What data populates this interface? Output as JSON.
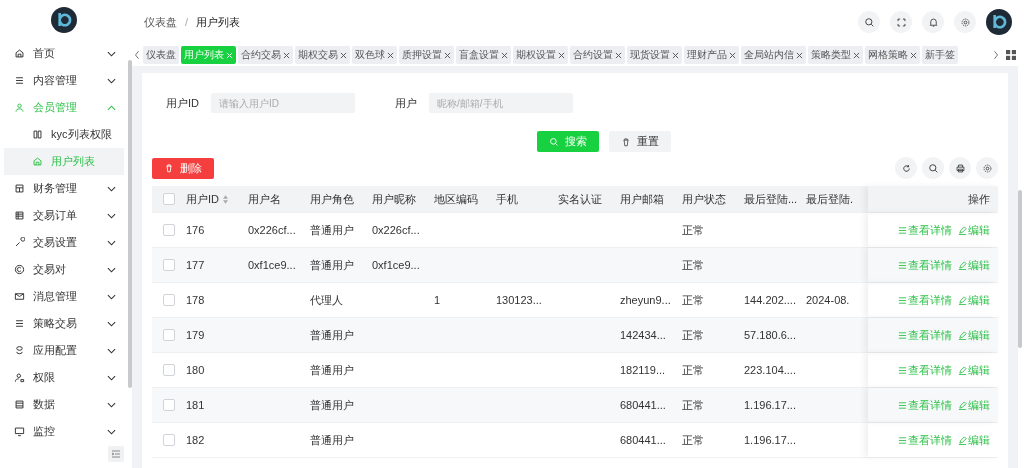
{
  "header": {
    "breadcrumb_separator": "/",
    "breadcrumb": [
      {
        "label": "仪表盘",
        "selected": false
      },
      {
        "label": "用户列表",
        "selected": true
      }
    ]
  },
  "sidebar": {
    "items": [
      {
        "label": "首页",
        "expanded": false
      },
      {
        "label": "内容管理",
        "expanded": false
      },
      {
        "label": "会员管理",
        "expanded": true,
        "children": [
          {
            "label": "kyc列表权限",
            "selected": false
          },
          {
            "label": "用户列表",
            "selected": true
          }
        ]
      },
      {
        "label": "财务管理",
        "expanded": false
      },
      {
        "label": "交易订单",
        "expanded": false
      },
      {
        "label": "交易设置",
        "expanded": false
      },
      {
        "label": "交易对",
        "expanded": false
      },
      {
        "label": "消息管理",
        "expanded": false
      },
      {
        "label": "策略交易",
        "expanded": false
      },
      {
        "label": "应用配置",
        "expanded": false
      },
      {
        "label": "权限",
        "expanded": false
      },
      {
        "label": "数据",
        "expanded": false
      },
      {
        "label": "监控",
        "expanded": false
      }
    ]
  },
  "tabs": [
    {
      "label": "仪表盘",
      "selected": false,
      "closable": false
    },
    {
      "label": "用户列表",
      "selected": true,
      "closable": true
    },
    {
      "label": "合约交易",
      "selected": false,
      "closable": true
    },
    {
      "label": "期权交易",
      "selected": false,
      "closable": true
    },
    {
      "label": "双色球",
      "selected": false,
      "closable": true
    },
    {
      "label": "质押设置",
      "selected": false,
      "closable": true
    },
    {
      "label": "盲盒设置",
      "selected": false,
      "closable": true
    },
    {
      "label": "期权设置",
      "selected": false,
      "closable": true
    },
    {
      "label": "合约设置",
      "selected": false,
      "closable": true
    },
    {
      "label": "现货设置",
      "selected": false,
      "closable": true
    },
    {
      "label": "理财产品",
      "selected": false,
      "closable": true
    },
    {
      "label": "全局站内信",
      "selected": false,
      "closable": true
    },
    {
      "label": "策略类型",
      "selected": false,
      "closable": true
    },
    {
      "label": "网格策略",
      "selected": false,
      "closable": true
    },
    {
      "label": "新手签",
      "selected": false,
      "closable": false
    }
  ],
  "filters": [
    {
      "label": "用户ID",
      "placeholder": "请输入用户ID"
    },
    {
      "label": "用户",
      "placeholder": "昵称/邮箱/手机"
    }
  ],
  "buttons": {
    "search": "搜索",
    "reset": "重置",
    "delete": "删除"
  },
  "table": {
    "select_all": {
      "checked": false
    },
    "columns": [
      {
        "label": "用户ID",
        "sortable": true
      },
      {
        "label": "用户名",
        "sortable": false
      },
      {
        "label": "用户角色",
        "sortable": false
      },
      {
        "label": "用户昵称",
        "sortable": false
      },
      {
        "label": "地区编码",
        "sortable": false
      },
      {
        "label": "手机",
        "sortable": false
      },
      {
        "label": "实名认证",
        "sortable": false
      },
      {
        "label": "用户邮箱",
        "sortable": false
      },
      {
        "label": "用户状态",
        "sortable": false
      },
      {
        "label": "最后登陆...",
        "sortable": false
      },
      {
        "label": "最后登陆.",
        "sortable": false
      }
    ],
    "action_column": "操作",
    "rows": [
      {
        "checked": false,
        "cells": [
          "176",
          "0x226cf...",
          "普通用户",
          "0x226cf...",
          "",
          "",
          "",
          "",
          "正常",
          "",
          ""
        ],
        "actions": [
          {
            "kind": "view",
            "label": "查看详情"
          },
          {
            "kind": "edit",
            "label": "编辑"
          }
        ]
      },
      {
        "checked": false,
        "cells": [
          "177",
          "0xf1ce9...",
          "普通用户",
          "0xf1ce9...",
          "",
          "",
          "",
          "",
          "正常",
          "",
          ""
        ],
        "actions": [
          {
            "kind": "view",
            "label": "查看详情"
          },
          {
            "kind": "edit",
            "label": "编辑"
          }
        ]
      },
      {
        "checked": false,
        "cells": [
          "178",
          "",
          "代理人",
          "",
          "1",
          "130123...",
          "",
          "zheyun9...",
          "正常",
          "144.202....",
          "2024-08."
        ],
        "actions": [
          {
            "kind": "view",
            "label": "查看详情"
          },
          {
            "kind": "edit",
            "label": "编辑"
          }
        ]
      },
      {
        "checked": false,
        "cells": [
          "179",
          "",
          "普通用户",
          "",
          "",
          "",
          "",
          "142434...",
          "正常",
          "57.180.6...",
          ""
        ],
        "actions": [
          {
            "kind": "view",
            "label": "查看详情"
          },
          {
            "kind": "edit",
            "label": "编辑"
          }
        ]
      },
      {
        "checked": false,
        "cells": [
          "180",
          "",
          "普通用户",
          "",
          "",
          "",
          "",
          "182119...",
          "正常",
          "223.104....",
          ""
        ],
        "actions": [
          {
            "kind": "view",
            "label": "查看详情"
          },
          {
            "kind": "edit",
            "label": "编辑"
          }
        ]
      },
      {
        "checked": false,
        "cells": [
          "181",
          "",
          "普通用户",
          "",
          "",
          "",
          "",
          "680441...",
          "正常",
          "1.196.17...",
          ""
        ],
        "actions": [
          {
            "kind": "view",
            "label": "查看详情"
          },
          {
            "kind": "edit",
            "label": "编辑"
          }
        ]
      },
      {
        "checked": false,
        "cells": [
          "182",
          "",
          "普通用户",
          "",
          "",
          "",
          "",
          "680441...",
          "正常",
          "1.196.17...",
          ""
        ],
        "actions": [
          {
            "kind": "view",
            "label": "查看详情"
          },
          {
            "kind": "edit",
            "label": "编辑"
          }
        ]
      }
    ]
  }
}
